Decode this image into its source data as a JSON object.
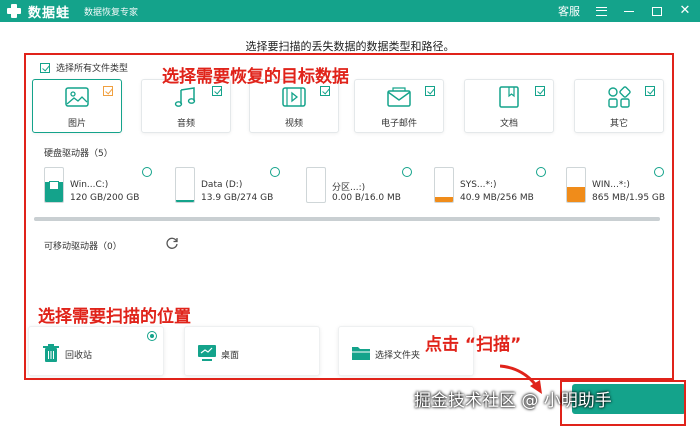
{
  "titlebar": {
    "app_name": "数据蛙",
    "subtitle": "数据恢复专家",
    "service": "客服",
    "accent": "#14a38b"
  },
  "instruction": "选择要扫描的丢失数据的数据类型和路径。",
  "select_all": {
    "label": "选择所有文件类型",
    "checked": true
  },
  "annotations": {
    "types": "选择需要恢复的目标数据",
    "location": "选择需要扫描的位置",
    "scan": "点击 “扫描”",
    "color": "#e0231a"
  },
  "file_types": [
    {
      "label": "图片",
      "icon": "picture-icon",
      "checked": true,
      "selected": true
    },
    {
      "label": "音频",
      "icon": "music-icon",
      "checked": true
    },
    {
      "label": "视频",
      "icon": "video-icon",
      "checked": true
    },
    {
      "label": "电子邮件",
      "icon": "mail-icon",
      "checked": true
    },
    {
      "label": "文档",
      "icon": "document-icon",
      "checked": true
    },
    {
      "label": "其它",
      "icon": "other-icon",
      "checked": true
    }
  ],
  "hard_drives": {
    "title": "硬盘驱动器（5）",
    "items": [
      {
        "name": "Win...C:)",
        "size": "120 GB/200 GB",
        "usage": 0.6,
        "fill_color": "#14a38b"
      },
      {
        "name": "Data (D:)",
        "size": "13.9 GB/274 GB",
        "usage": 0.05,
        "fill_color": "#14a38b"
      },
      {
        "name": "分区...:)",
        "size": "0.00  B/16.0 MB",
        "usage": 0.0,
        "fill_color": "#14a38b"
      },
      {
        "name": "SYS...*:)",
        "size": "40.9 MB/256 MB",
        "usage": 0.16,
        "fill_color": "#f08c1a"
      },
      {
        "name": "WIN...*:)",
        "size": "865 MB/1.95 GB",
        "usage": 0.44,
        "fill_color": "#f08c1a"
      }
    ]
  },
  "removable": {
    "title": "可移动驱动器（0）"
  },
  "locations": [
    {
      "label": "回收站",
      "icon": "recycle-bin-icon",
      "selected": true
    },
    {
      "label": "桌面",
      "icon": "desktop-icon",
      "selected": false
    },
    {
      "label": "选择文件夹",
      "icon": "folder-icon",
      "selected": false
    }
  ],
  "watermark": "掘金技术社区 @ 小明助手"
}
